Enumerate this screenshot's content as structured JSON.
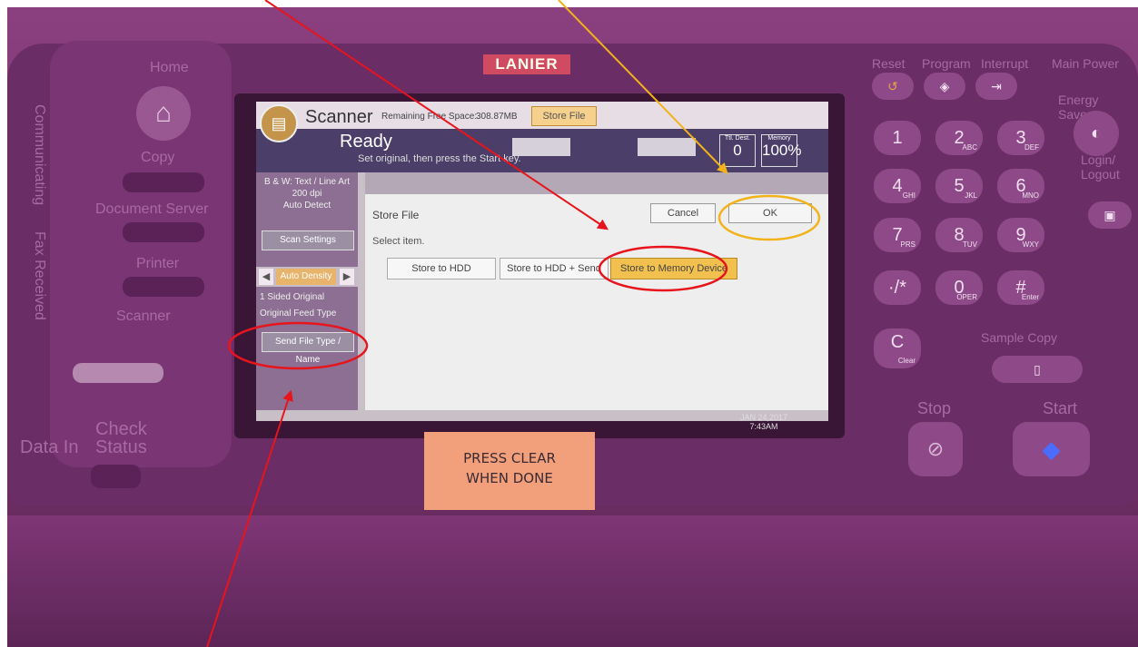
{
  "brand": "LANIER",
  "left_panel": {
    "home": "Home",
    "items": [
      "Copy",
      "Document Server",
      "Printer",
      "Scanner"
    ],
    "vertical_labels": [
      "Communicating",
      "Fax Received"
    ],
    "check_status": "Check Status",
    "data_in": "Data In"
  },
  "screen": {
    "title": "Scanner",
    "remaining_label": "Remaining Free Space:",
    "remaining_value": "308.87MB",
    "store_file_tab": "Store File",
    "status": "Ready",
    "status_message": "Set original, then press the Start key.",
    "ttl_dest_label": "Ttl. Dest.",
    "ttl_dest_value": "0",
    "memory_label": "Memory",
    "memory_value": "100%",
    "settings": {
      "info_lines": [
        "B & W: Text / Line Art",
        "200 dpi",
        "Auto Detect"
      ],
      "scan_settings": "Scan Settings",
      "auto_density": "Auto Density",
      "sided": "1 Sided Original",
      "feed_type": "Original Feed Type",
      "send_file_type": "Send File Type / Name"
    },
    "dialog": {
      "title": "Store File",
      "cancel": "Cancel",
      "ok": "OK",
      "select_label": "Select item.",
      "options": [
        "Store to HDD",
        "Store to HDD + Send",
        "Store to Memory Device"
      ],
      "selected_index": 2
    },
    "date": "JAN 24,2017",
    "time": "7:43AM"
  },
  "keypad": {
    "top_labels": [
      "Reset",
      "Program",
      "Interrupt"
    ],
    "main_power": "Main Power",
    "energy_saver": "Energy Saver",
    "login": "Login/ Logout",
    "keys": [
      {
        "main": "1",
        "sub": ""
      },
      {
        "main": "2",
        "sub": "ABC"
      },
      {
        "main": "3",
        "sub": "DEF"
      },
      {
        "main": "4",
        "sub": "GHI"
      },
      {
        "main": "5",
        "sub": "JKL"
      },
      {
        "main": "6",
        "sub": "MNO"
      },
      {
        "main": "7",
        "sub": "PRS"
      },
      {
        "main": "8",
        "sub": "TUV"
      },
      {
        "main": "9",
        "sub": "WXY"
      },
      {
        "main": "·/*",
        "sub": ""
      },
      {
        "main": "0",
        "sub": "OPER"
      },
      {
        "main": "#",
        "sub": "Enter"
      }
    ],
    "clear": "Clear",
    "sample_copy": "Sample Copy",
    "stop": "Stop",
    "start": "Start"
  },
  "sticky_note": [
    "PRESS CLEAR",
    "WHEN DONE"
  ],
  "colors": {
    "annotation_red": "#e8141c",
    "annotation_yellow": "#f2b21a",
    "selected_option": "#f2c04e"
  }
}
